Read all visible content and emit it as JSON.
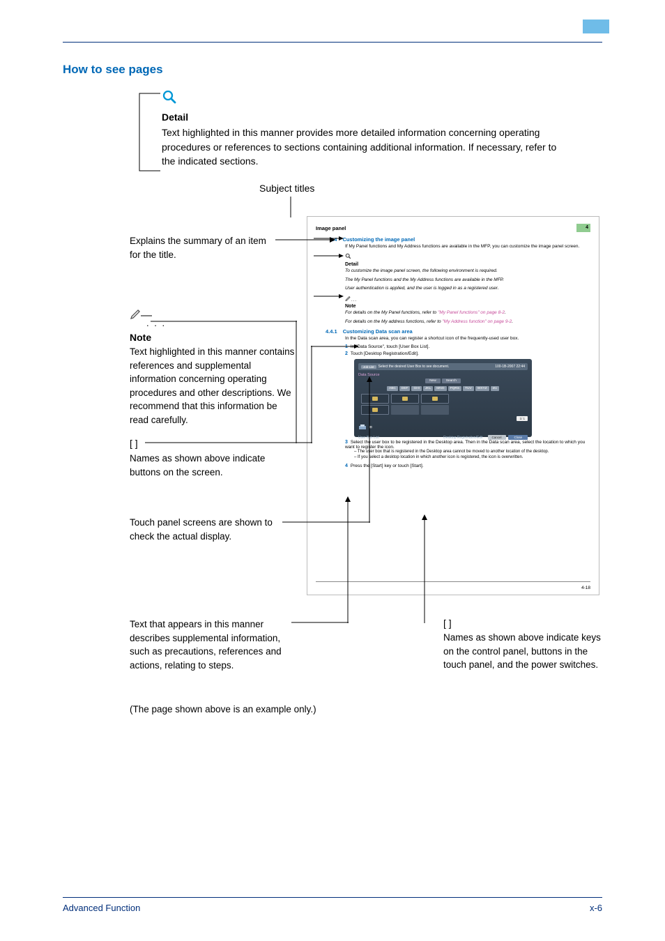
{
  "section_title": "How to see pages",
  "detail": {
    "heading": "Detail",
    "body": "Text highlighted in this manner provides more detailed information concerning operating procedures or references to sections containing additional information. If necessary, refer to the indicated sections."
  },
  "subject_titles_label": "Subject titles",
  "callouts": {
    "summary": "Explains the summary of an item for  the title.",
    "note_heading": "Note",
    "note_body": "Text highlighted in this manner contains references and supplemental information concerning operating procedures and other descriptions. We recommend that this information be read carefully.",
    "brackets_left": "[   ]",
    "buttons": "Names as shown above indicate buttons on the screen.",
    "touchpanel": "Touch panel screens are shown to check the actual display.",
    "supplemental": "Text that appears in this manner describes supplemental information, such as precautions, references and actions, relating to steps.",
    "brackets_right": "[   ]",
    "keys": "Names as shown above indicate keys on the control panel, buttons in the touch panel, and the power switches."
  },
  "inset": {
    "header_label": "Image panel",
    "chapter": "4",
    "sec1_num": "4.4",
    "sec1_title": "Customizing the image panel",
    "sec1_body": "If My Panel functions and My Address functions are available in the MFP, you can customize the image panel screen.",
    "detail_heading": "Detail",
    "detail_l1": "To customize the image panel screen, the following environment is required.",
    "detail_l2": "The My Panel functions and the My Address functions are available in the MFP.",
    "detail_l3": "User authentication is applied, and the user is logged in as a registered user.",
    "note_heading": "Note",
    "note_l1a": "For details on the My Panel functions, refer to ",
    "note_l1b": "\"My Panel functions\" on page 8-2",
    "note_l2a": "For details on the My address functions, refer to ",
    "note_l2b": "\"My Address function\" on page 9-2",
    "sec2_num": "4.4.1",
    "sec2_title": "Customizing Data scan area",
    "sec2_body": "In the Data scan area, you can register a shortcut icon of the frequently-used user box.",
    "step1": "In \"Data Source\", touch [User Box List].",
    "step2": "Touch [Desktop Registration/Edit].",
    "tp_top_left": "Select the desired User Box to see document.",
    "tp_top_right": "100-1B-2007 22:44",
    "tp_data_source": "Data Source",
    "tp_btns1": [
      "New",
      "Search"
    ],
    "tp_btns2": [
      "ABC",
      "DEF",
      "GHI",
      "JKL",
      "MNO",
      "PQRS",
      "TUV",
      "WXYZ",
      "etc"
    ],
    "tp_paging": "1/  1",
    "tp_footer_left": "User Box List",
    "tp_footer_label": "Desktop Registration/Edit",
    "tp_cancel": "Cancel",
    "tp_close": "Close",
    "step3": "Select the user box to be registered in the Desktop area. Then in the Data scan area, select the location to which you want to register the icon.",
    "sub1": "The user box that is registered in the Desktop area cannot be moved to another location of the desktop.",
    "sub2": "If you select a desktop location in which another icon is registered, the icon is overwritten.",
    "step4": "Press the [Start] key or touch [Start].",
    "pagenum": "4-18"
  },
  "example_note": "(The page shown above is an example only.)",
  "footer": {
    "left": "Advanced Function",
    "right": "x-6"
  }
}
